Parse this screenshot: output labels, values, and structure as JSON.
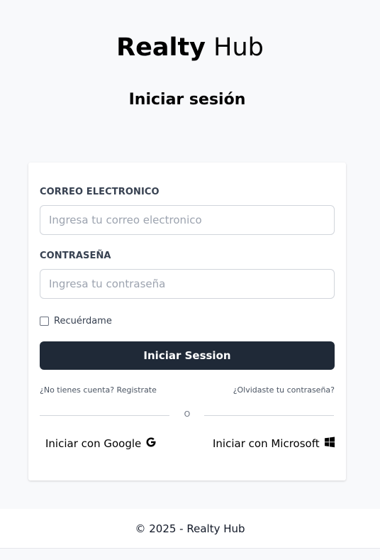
{
  "brand": {
    "bold": "Realty",
    "light": "Hub"
  },
  "page_title": "Iniciar sesión",
  "form": {
    "email_label": "CORREO ELECTRONICO",
    "email_placeholder": "Ingresa tu correo electronico",
    "email_value": "",
    "password_label": "CONTRASEÑA",
    "password_placeholder": "Ingresa tu contraseña",
    "password_value": "",
    "remember_label": "Recuérdame",
    "remember_checked": false,
    "submit_label": "Iniciar Session",
    "register_link": "¿No tienes cuenta? Registrate",
    "forgot_link": "¿Olvidaste tu contraseña?",
    "divider_text": "O",
    "google_label": "Iniciar con Google",
    "google_icon": "google-icon",
    "microsoft_label": "Iniciar con Microsoft",
    "microsoft_icon": "windows-icon"
  },
  "footer": {
    "text": "© 2025 - Realty Hub"
  }
}
